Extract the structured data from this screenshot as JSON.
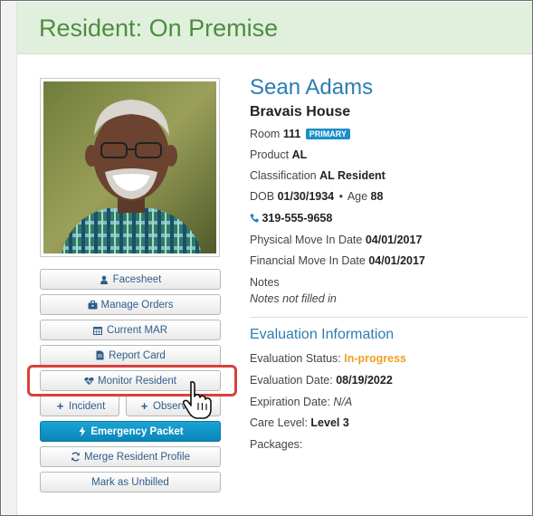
{
  "header": {
    "title": "Resident: On Premise"
  },
  "resident": {
    "name": "Sean Adams",
    "house": "Bravais House",
    "room_label": "Room",
    "room_value": "111",
    "room_badge": "PRIMARY",
    "product_label": "Product",
    "product_value": "AL",
    "classification_label": "Classification",
    "classification_value": "AL Resident",
    "dob_label": "DOB",
    "dob_value": "01/30/1934",
    "age_sep": "•",
    "age_label": "Age",
    "age_value": "88",
    "phone": "319-555-9658",
    "physical_move_label": "Physical Move In Date",
    "physical_move_value": "04/01/2017",
    "financial_move_label": "Financial Move In Date",
    "financial_move_value": "04/01/2017",
    "notes_label": "Notes",
    "notes_value": "Notes not filled in"
  },
  "evaluation": {
    "title": "Evaluation Information",
    "status_label": "Evaluation Status:",
    "status_value": "In-progress",
    "status_color": "#f0a020",
    "date_label": "Evaluation Date:",
    "date_value": "08/19/2022",
    "expiration_label": "Expiration Date:",
    "expiration_value": "N/A",
    "care_label": "Care Level:",
    "care_value": "Level 3",
    "packages_label": "Packages:"
  },
  "actions": {
    "facesheet": "Facesheet",
    "manage_orders": "Manage Orders",
    "current_mar": "Current MAR",
    "report_card": "Report Card",
    "monitor_resident": "Monitor Resident",
    "incident": "Incident",
    "observation": "Observa",
    "emergency_packet": "Emergency Packet",
    "merge_profile": "Merge Resident Profile",
    "mark_unbilled": "Mark as Unbilled"
  },
  "icons": {
    "facesheet": "user-icon",
    "manage_orders": "briefcase-icon",
    "current_mar": "calendar-icon",
    "report_card": "document-icon",
    "monitor_resident": "heartbeat-icon",
    "incident": "plus-icon",
    "observation": "plus-icon",
    "emergency_packet": "bolt-icon",
    "merge_profile": "refresh-icon",
    "phone": "phone-icon",
    "cursor": "hand-pointer-icon"
  },
  "colors": {
    "header_bg": "#e0f0dd",
    "header_text": "#4e8d3f",
    "name_text": "#2b7db2",
    "primary_button": "#0a86b8",
    "highlight": "#d9413d"
  }
}
